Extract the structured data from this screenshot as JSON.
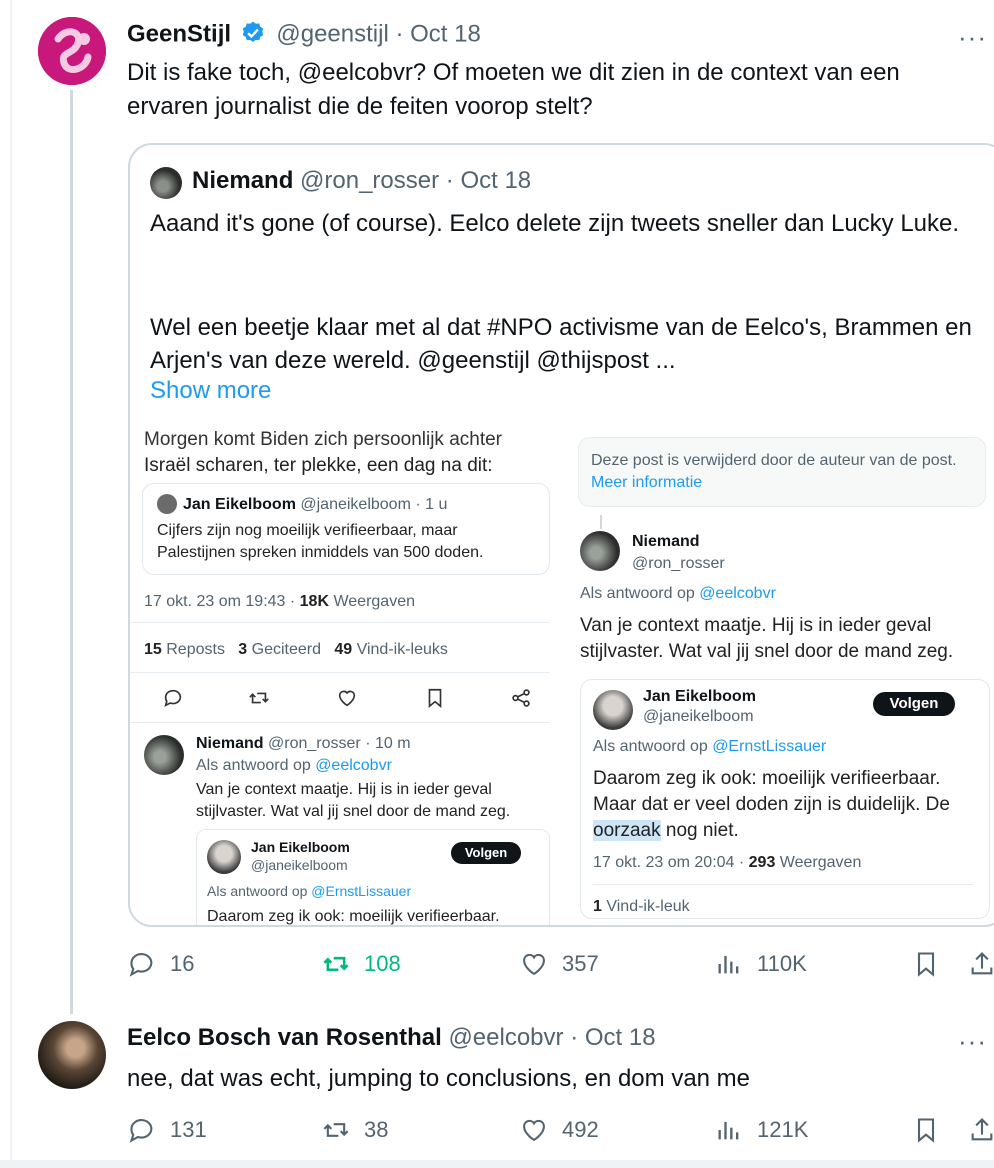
{
  "post1": {
    "name": "GeenStijl",
    "handle": "@geenstijl",
    "date": "· Oct 18",
    "text": "Dit is fake toch, @eelcobvr? Of moeten we dit zien in de context van een ervaren journalist die de feiten voorop stelt?",
    "stats": {
      "replies": "16",
      "reposts": "108",
      "likes": "357",
      "views": "110K"
    }
  },
  "quote": {
    "name": "Niemand",
    "handle": "@ron_rosser",
    "date": "· Oct 18",
    "text1": "Aaand it's gone (of course). Eelco delete zijn tweets sneller dan Lucky Luke.",
    "text2": "Wel een beetje klaar met al dat #NPO activisme van de Eelco's, Brammen en Arjen's van deze wereld. @geenstijl @thijspost ...",
    "show_more": "Show more"
  },
  "left_shot": {
    "top_text_cut": "Morgen komt Biden zich persoonlijk achter",
    "top_text": "Israël scharen, ter plekke, een dag na dit:",
    "embedded": {
      "name": "Jan Eikelboom",
      "handle": "@janeikelboom",
      "time": "· 1 u",
      "text": "Cijfers zijn nog moeilijk verifieerbaar, maar Palestijnen spreken inmiddels van 500 doden."
    },
    "meta_time": "17 okt. 23 om 19:43 · ",
    "meta_views_num": "18K",
    "meta_views_label": " Weergaven",
    "reposts_num": "15",
    "reposts_label": " Reposts",
    "quotes_num": "3",
    "quotes_label": " Geciteerd",
    "likes_num": "49",
    "likes_label": " Vind-ik-leuks",
    "reply": {
      "name": "Niemand",
      "handle": "@ron_rosser · 10 m",
      "in_reply_prefix": "Als antwoord op ",
      "in_reply_user": "@eelcobvr",
      "text": "Van je context maatje. Hij is in ieder geval stijlvaster. Wat val jij snel door de mand zeg."
    },
    "nested": {
      "name": "Jan Eikelboom",
      "handle": "@janeikelboom",
      "follow": "Volgen",
      "in_reply_prefix": "Als antwoord op ",
      "in_reply_user": "@ErnstLissauer",
      "text": "Daarom zeg ik ook: moeilijk verifieerbaar."
    }
  },
  "right_shot": {
    "deleted_text": "Deze post is verwijderd door de auteur van de post. ",
    "deleted_link": "Meer informatie",
    "reply": {
      "name": "Niemand",
      "handle": "@ron_rosser",
      "in_reply_prefix": "Als antwoord op ",
      "in_reply_user": "@eelcobvr",
      "text": "Van je context maatje. Hij is in ieder geval stijlvaster. Wat val jij snel door de mand zeg."
    },
    "nested": {
      "name": "Jan Eikelboom",
      "handle": "@janeikelboom",
      "follow": "Volgen",
      "in_reply_prefix": "Als antwoord op ",
      "in_reply_user": "@ErnstLissauer",
      "text_a": "Daarom zeg ik ook: moeilijk verifieerbaar. Maar dat er veel doden zijn is duidelijk. De ",
      "text_hl": "oorzaak",
      "text_b": " nog niet.",
      "meta_time": "17 okt. 23 om 20:04 · ",
      "meta_views_num": "293",
      "meta_views_label": " Weergaven",
      "likes_num": "1",
      "likes_label": " Vind-ik-leuk"
    }
  },
  "post2": {
    "name": "Eelco Bosch van Rosenthal",
    "handle": "@eelcobvr",
    "date": "· Oct 18",
    "text": "nee, dat was echt, jumping to conclusions, en dom van me",
    "stats": {
      "replies": "131",
      "reposts": "38",
      "likes": "492",
      "views": "121K"
    }
  },
  "colors": {
    "accent": "#1d9bf0",
    "repost_active": "#00ba7c",
    "muted": "#536471"
  }
}
